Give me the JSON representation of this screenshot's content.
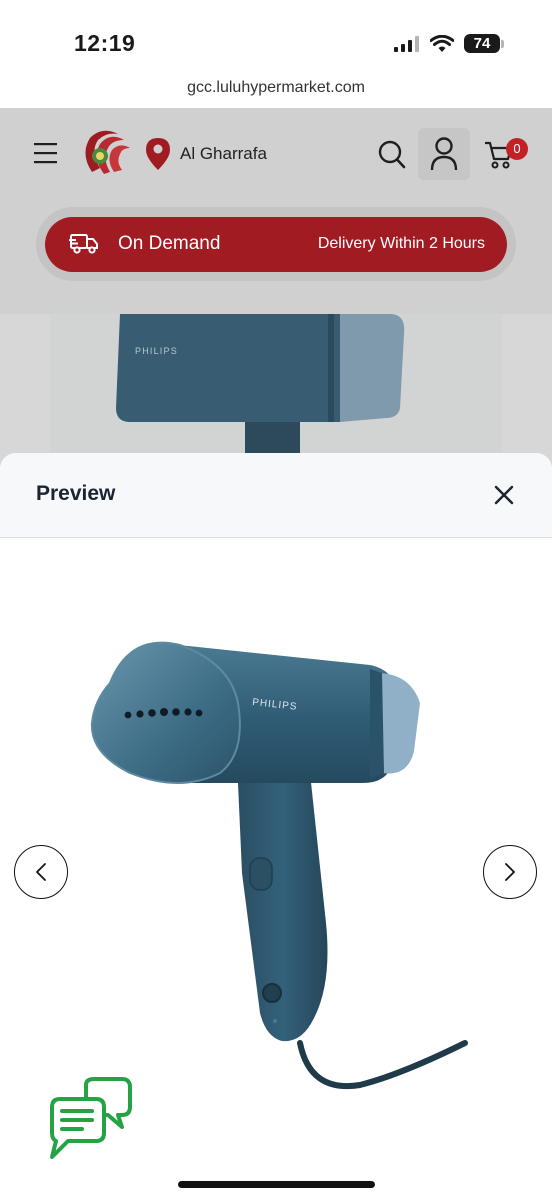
{
  "status_bar": {
    "time": "12:19",
    "battery": "74"
  },
  "browser": {
    "url": "gcc.luluhypermarket.com"
  },
  "header": {
    "location": "Al Gharrafa",
    "cart_count": "0",
    "on_demand": {
      "title": "On Demand",
      "subtitle": "Delivery Within 2 Hours"
    }
  },
  "background_product": {
    "brand": "PHILIPS"
  },
  "preview": {
    "title": "Preview",
    "product_brand": "PHILIPS"
  },
  "colors": {
    "brand_red": "#a11b22",
    "product_blue": "#2e5a72",
    "chat_green": "#25a244"
  }
}
